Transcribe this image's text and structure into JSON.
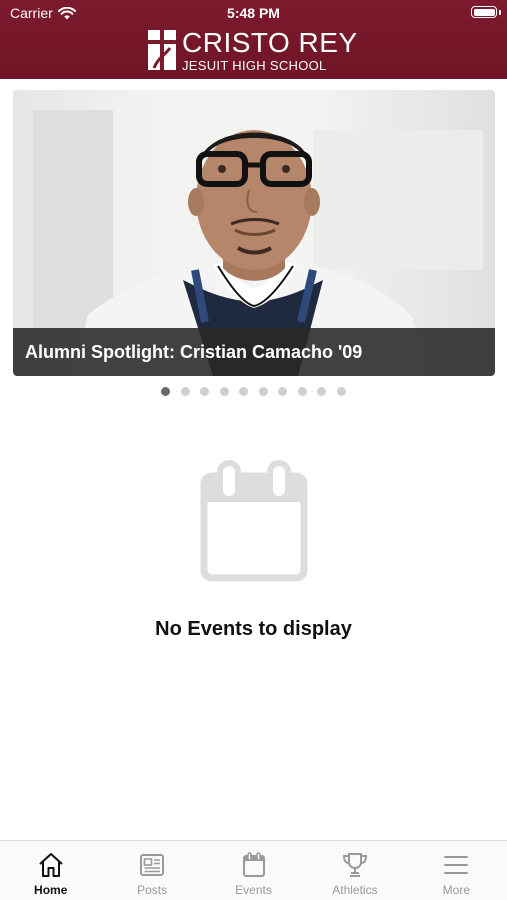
{
  "status_bar": {
    "carrier": "Carrier",
    "time": "5:48 PM"
  },
  "header": {
    "logo_line1": "CRISTO REY",
    "logo_line2": "JESUIT HIGH SCHOOL",
    "background_color": "#7d1a2e"
  },
  "carousel": {
    "caption": "Alumni Spotlight: Cristian Camacho '09",
    "slide_count": 10,
    "active_index": 0
  },
  "events": {
    "empty_message": "No Events to display",
    "empty_icon": "calendar-icon"
  },
  "tabs": [
    {
      "label": "Home",
      "icon": "home-icon",
      "active": true
    },
    {
      "label": "Posts",
      "icon": "newspaper-icon",
      "active": false
    },
    {
      "label": "Events",
      "icon": "calendar-icon",
      "active": false
    },
    {
      "label": "Athletics",
      "icon": "trophy-icon",
      "active": false
    },
    {
      "label": "More",
      "icon": "menu-icon",
      "active": false
    }
  ]
}
